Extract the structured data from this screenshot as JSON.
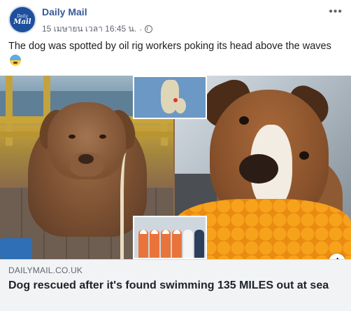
{
  "post": {
    "page_name": "Daily Mail",
    "avatar_text_top": "Daily",
    "avatar_text_bottom": "Mail",
    "timestamp": "15 เมษายน เวลา 16:45 น.",
    "separator": "·",
    "more_icon": "more-options-icon",
    "privacy_icon": "globe-icon",
    "caption": "The dog was spotted by oil rig workers poking its head above the waves",
    "caption_emoji": "anxious-face-emoji"
  },
  "link_preview": {
    "domain": "DAILYMAIL.CO.UK",
    "headline": "Dog rescued after it's found swimming 135 MILES out at sea",
    "info_icon_label": "i"
  },
  "colors": {
    "page_name": "#385898",
    "link_bg": "#f2f3f5",
    "avatar_bg": "#1d4f9c"
  }
}
